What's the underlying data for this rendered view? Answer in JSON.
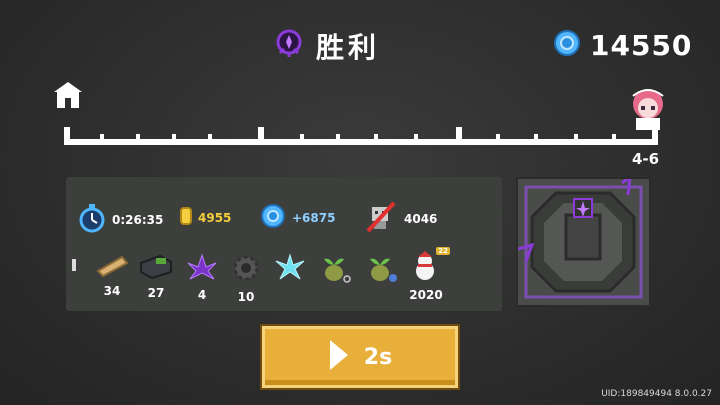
{
  "header": {
    "title": "胜利",
    "gems": "14550"
  },
  "progress": {
    "stage": "4-6",
    "completion": 1.0
  },
  "stats": {
    "time": "0:26:35",
    "gold": "4955",
    "gems_gained": "+6875",
    "kills": "4046"
  },
  "items": [
    {
      "icon": "fragment-icon",
      "count": ""
    },
    {
      "icon": "wood-log-icon",
      "count": "34"
    },
    {
      "icon": "ore-crate-icon",
      "count": "27"
    },
    {
      "icon": "purple-crystal-icon",
      "count": "4"
    },
    {
      "icon": "gear-part-icon",
      "count": "10"
    },
    {
      "icon": "ice-crystal-icon",
      "count": ""
    },
    {
      "icon": "seed-sprout-icon",
      "count": ""
    },
    {
      "icon": "seed-sprout-flower-icon",
      "count": ""
    },
    {
      "icon": "snowman-icon",
      "count": "2020",
      "badge": "22"
    }
  ],
  "button": {
    "label": "2s"
  },
  "footer": {
    "uid": "UID:189849494 8.0.0.27"
  },
  "colors": {
    "gold": "#f4d03f",
    "accent_button": "#e8b03a",
    "gem_blue": "#4fb6ff",
    "purple": "#8a3bd8"
  }
}
